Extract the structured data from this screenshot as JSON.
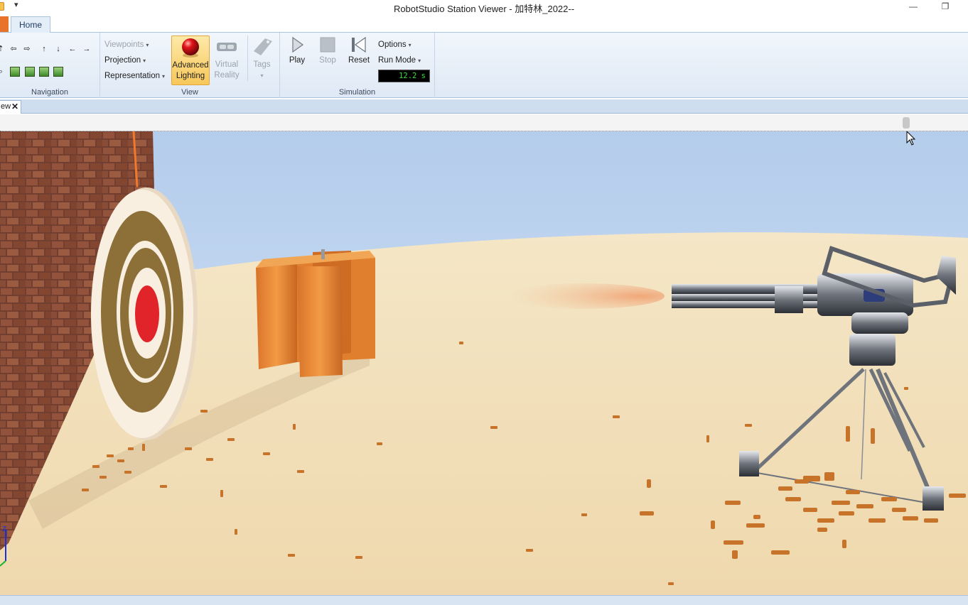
{
  "window": {
    "title": "RobotStudio Station Viewer - 加特林_2022--",
    "quick_access_caret": "▾",
    "minimize": "—",
    "restore": "❐"
  },
  "tabs": {
    "home": "Home"
  },
  "ribbon": {
    "navigation": {
      "label": "Navigation"
    },
    "view": {
      "label": "View",
      "viewpoints": "Viewpoints",
      "projection": "Projection",
      "representation": "Representation",
      "advanced_lighting": [
        "Advanced",
        "Lighting"
      ],
      "virtual_reality": [
        "Virtual",
        "Reality"
      ],
      "tags": "Tags"
    },
    "simulation": {
      "label": "Simulation",
      "play": "Play",
      "stop": "Stop",
      "reset": "Reset",
      "options": "Options",
      "run_mode": "Run Mode",
      "timer": "12.2 s"
    }
  },
  "document_tab": {
    "label": "ew",
    "close": "✕"
  },
  "colors": {
    "sky": "#bcd3ef",
    "floor": "#f0dcb3",
    "target_red": "#e0242a",
    "brick": "#8a4a33",
    "wood": "#e8872f",
    "shell": "#c8732a"
  },
  "icons": [
    "orbit-icon",
    "pan-icon",
    "zoom-icon",
    "view-cube-icon",
    "advanced-lighting-icon",
    "vr-headset-icon",
    "tag-icon",
    "play-icon",
    "stop-icon",
    "reset-icon"
  ]
}
